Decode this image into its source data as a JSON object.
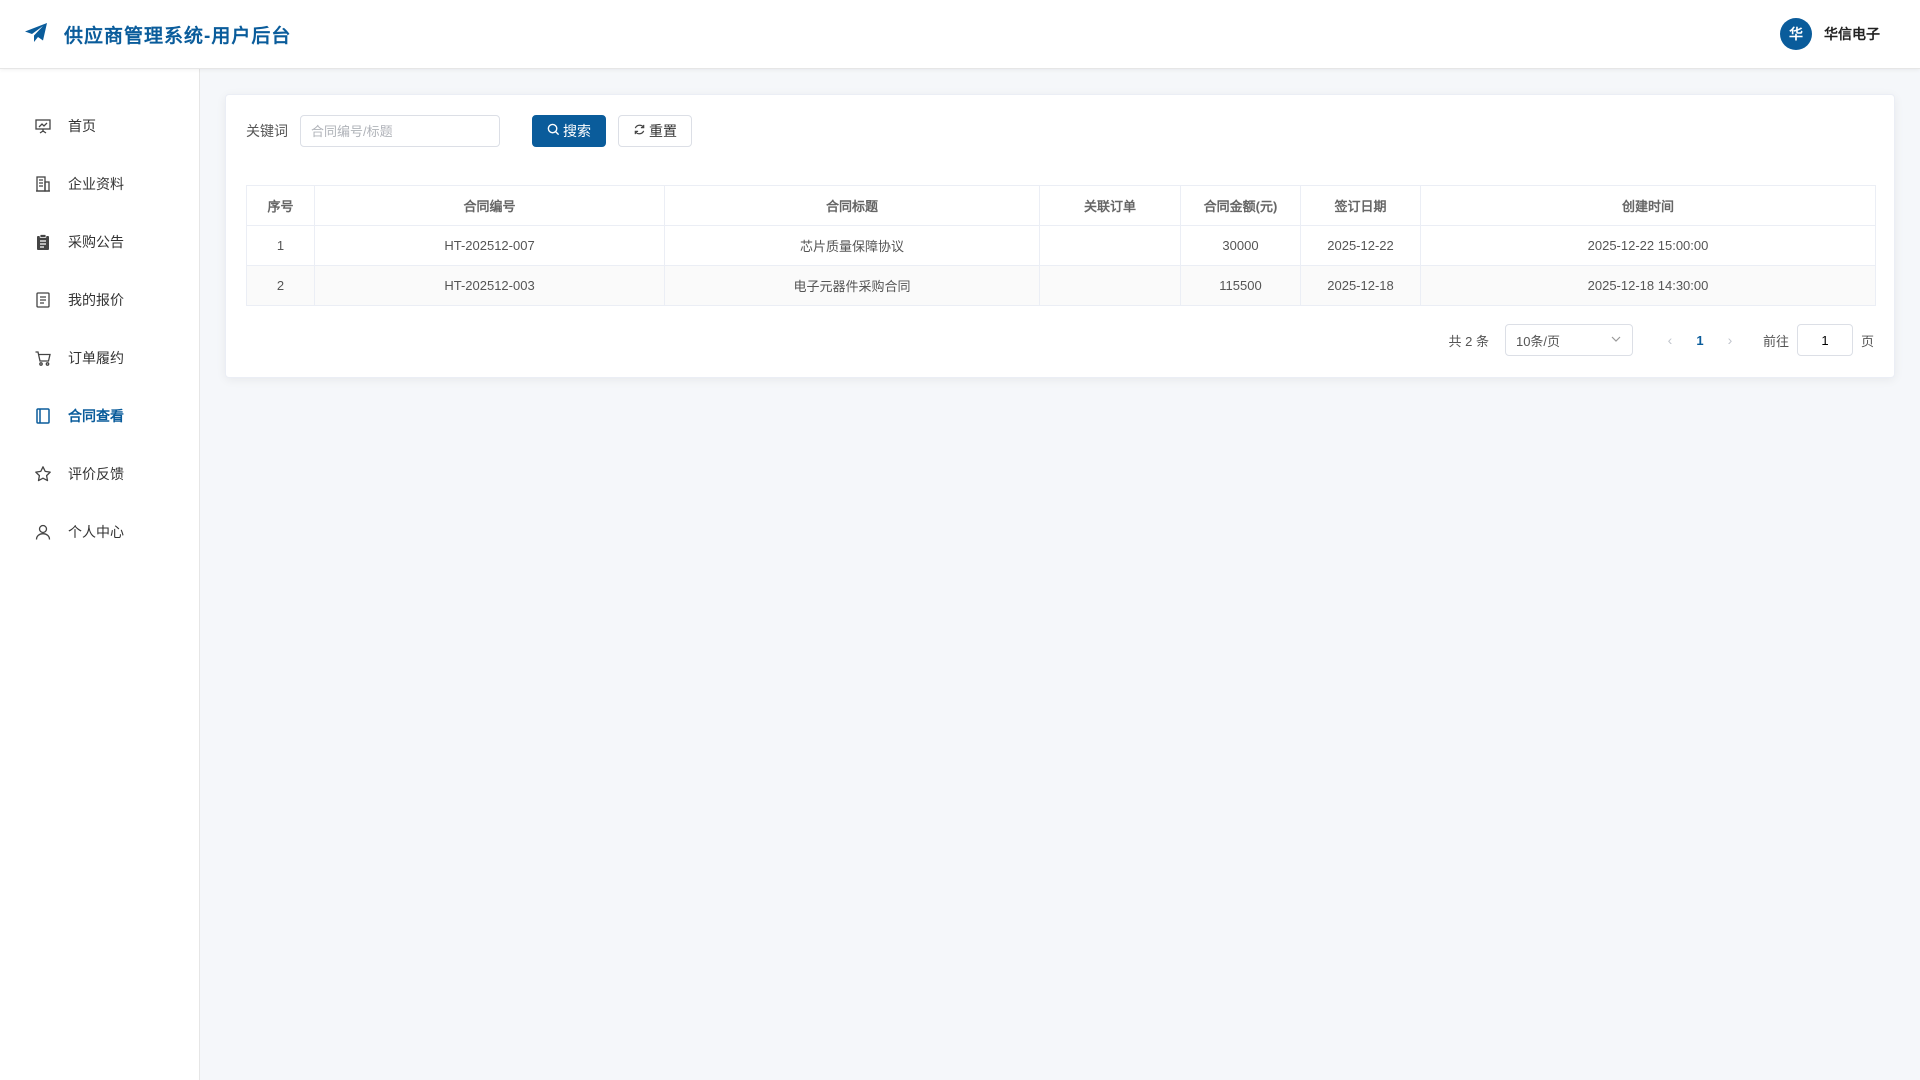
{
  "header": {
    "title": "供应商管理系统-用户后台",
    "user_avatar_text": "华",
    "user_name": "华信电子"
  },
  "sidebar": {
    "items": [
      {
        "label": "首页",
        "icon": "presentation-chart-icon"
      },
      {
        "label": "企业资料",
        "icon": "building-icon"
      },
      {
        "label": "采购公告",
        "icon": "clipboard-icon"
      },
      {
        "label": "我的报价",
        "icon": "document-icon"
      },
      {
        "label": "订单履约",
        "icon": "shopping-cart-icon"
      },
      {
        "label": "合同查看",
        "icon": "notebook-icon",
        "active": true
      },
      {
        "label": "评价反馈",
        "icon": "star-icon"
      },
      {
        "label": "个人中心",
        "icon": "user-icon"
      }
    ]
  },
  "filter": {
    "label": "关键词",
    "placeholder": "合同编号/标题",
    "value": "",
    "search_label": "搜索",
    "reset_label": "重置"
  },
  "table": {
    "columns": [
      "序号",
      "合同编号",
      "合同标题",
      "关联订单",
      "合同金额(元)",
      "签订日期",
      "创建时间"
    ],
    "rows": [
      {
        "index": "1",
        "contract_no": "HT-202512-007",
        "title": "芯片质量保障协议",
        "order": "",
        "amount": "30000",
        "sign_date": "2025-12-22",
        "created": "2025-12-22 15:00:00"
      },
      {
        "index": "2",
        "contract_no": "HT-202512-003",
        "title": "电子元器件采购合同",
        "order": "",
        "amount": "115500",
        "sign_date": "2025-12-18",
        "created": "2025-12-18 14:30:00"
      }
    ]
  },
  "pagination": {
    "total_text": "共 2 条",
    "page_size": "10条/页",
    "current_page": "1",
    "goto_label": "前往",
    "goto_value": "1",
    "page_suffix": "页"
  },
  "colors": {
    "brand": "#0a5c9b",
    "background": "#f5f7fa"
  }
}
